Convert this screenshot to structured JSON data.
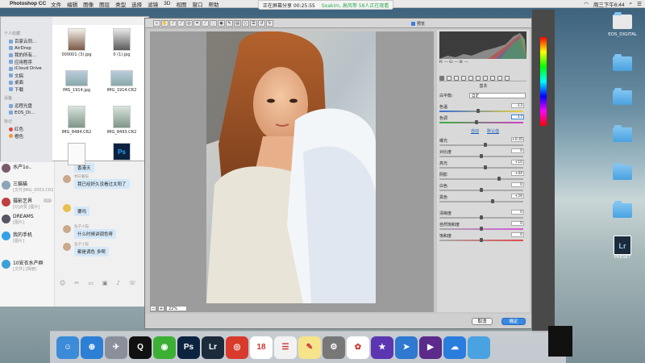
{
  "menubar": {
    "app": "Photoshop CC",
    "items": [
      "文件",
      "编辑",
      "图像",
      "图层",
      "类型",
      "选择",
      "滤镜",
      "3D",
      "视图",
      "窗口",
      "帮助"
    ],
    "right_status": "周三下午6:44"
  },
  "recording_banner": {
    "text": "正在屏幕分享 00:25:55",
    "extra": "Soakim, 高风等 58人正在观看"
  },
  "desktop_icons": [
    {
      "name": "folder",
      "label": ""
    },
    {
      "name": "EOS_DIGITAL",
      "label": "EOS_DIGITAL"
    },
    {
      "name": "folder2",
      "label": ""
    },
    {
      "name": "folder3",
      "label": ""
    },
    {
      "name": "folder4",
      "label": ""
    },
    {
      "name": "folder5",
      "label": ""
    },
    {
      "name": "folder6",
      "label": ""
    },
    {
      "name": "preset",
      "label": "PRESET"
    }
  ],
  "finder": {
    "sidebar": {
      "section_personal": "个人收藏",
      "items": [
        "百家云同...",
        "AirDrop",
        "我的所有...",
        "应用程序",
        "iCloud Drive",
        "文稿",
        "桌面",
        "下载"
      ],
      "section_devices": "设备",
      "devices": [
        "远程光盘",
        "EOS_DI..."
      ],
      "section_tags": "标记",
      "tags": [
        {
          "label": "红色",
          "color": "#e0443c"
        },
        {
          "label": "橙色",
          "color": "#f09a30"
        }
      ]
    },
    "files": [
      {
        "label": "000001 (3).jpg"
      },
      {
        "label": "0 (1).jpg"
      },
      {
        "label": "IMG_1914.jpg"
      },
      {
        "label": "IMG_1914.CR2"
      },
      {
        "label": "IMG_8484.CR2"
      },
      {
        "label": "IMG_8493.CR2"
      },
      {
        "label": ""
      },
      {
        "label": "Ps"
      }
    ]
  },
  "chat": {
    "contacts": [
      {
        "name": "水产1o..",
        "preview": "",
        "badge": ""
      },
      {
        "name": "三猫猫",
        "preview": "[文件]IMG_0003.CR2",
        "badge": ""
      },
      {
        "name": "摄影艺界",
        "preview": "[Q]点赞 [图片]",
        "badge": "37"
      },
      {
        "name": "DREAMS",
        "preview": "[图片]",
        "badge": ""
      },
      {
        "name": "我的手机",
        "preview": "[图片]",
        "badge": ""
      },
      {
        "name": "10安衣水产群",
        "preview": "[文件] [相册]",
        "badge": ""
      }
    ],
    "messages": [
      {
        "sender": "",
        "text": "香港天"
      },
      {
        "sender": "林日暮猫",
        "text": "我已经好久没看过太阳了"
      },
      {
        "sender": "",
        "text": "要吗"
      },
      {
        "sender": "鱼子小猫",
        "text": "什么时候讲调色呀"
      },
      {
        "sender": "鱼子小猫",
        "text": "都是调色 多啊"
      }
    ]
  },
  "acr": {
    "preview_label": "预览",
    "zoom": "22%",
    "tab_title": "基本",
    "wb_label": "白平衡:",
    "wb_value": "自定",
    "rgb_readout": "R: ---  G: ---  B: ---",
    "link_auto": "自动",
    "link_default": "默认值",
    "sliders": [
      {
        "label": "色温",
        "value": "-13",
        "pos": 0.46
      },
      {
        "label": "色调",
        "value": "-17",
        "pos": 0.44
      },
      {
        "label": "曝光",
        "value": "+0.45",
        "pos": 0.55
      },
      {
        "label": "对比度",
        "value": "0",
        "pos": 0.5
      },
      {
        "label": "高光",
        "value": "+10",
        "pos": 0.55
      },
      {
        "label": "阴影",
        "value": "+44",
        "pos": 0.72
      },
      {
        "label": "白色",
        "value": "0",
        "pos": 0.5
      },
      {
        "label": "黑色",
        "value": "+28",
        "pos": 0.64
      },
      {
        "label": "清晰度",
        "value": "0",
        "pos": 0.5
      },
      {
        "label": "自然饱和度",
        "value": "0",
        "pos": 0.5
      },
      {
        "label": "饱和度",
        "value": "0",
        "pos": 0.5
      }
    ],
    "cancel_label": "取消",
    "ok_label": "确定"
  },
  "dock": {
    "apps": [
      {
        "name": "finder",
        "glyph": "☺",
        "color": "#3b8bd8"
      },
      {
        "name": "safari",
        "glyph": "⊕",
        "color": "#2d7fd6"
      },
      {
        "name": "launchpad",
        "glyph": "✈",
        "color": "#8a8f9a"
      },
      {
        "name": "qq",
        "glyph": "Q",
        "color": "#111"
      },
      {
        "name": "wechat",
        "glyph": "◉",
        "color": "#3cb034"
      },
      {
        "name": "photoshop",
        "glyph": "Ps",
        "color": "#0c2340"
      },
      {
        "name": "lightroom",
        "glyph": "Lr",
        "color": "#1b2b3c"
      },
      {
        "name": "netease-music",
        "glyph": "◎",
        "color": "#d83a2c"
      },
      {
        "name": "calendar",
        "glyph": "18",
        "color": "#ffffff"
      },
      {
        "name": "reminders",
        "glyph": "☰",
        "color": "#f2f2f2"
      },
      {
        "name": "notes",
        "glyph": "✎",
        "color": "#f6e38a"
      },
      {
        "name": "system-preferences",
        "glyph": "⚙",
        "color": "#777"
      },
      {
        "name": "photos",
        "glyph": "✿",
        "color": "#ffffff"
      },
      {
        "name": "imovie",
        "glyph": "★",
        "color": "#5b36b0"
      },
      {
        "name": "feiyu",
        "glyph": "➤",
        "color": "#2f79d0"
      },
      {
        "name": "player",
        "glyph": "▶",
        "color": "#5b2a8a"
      },
      {
        "name": "baidu-netdisk",
        "glyph": "☁",
        "color": "#2a7ddc"
      },
      {
        "name": "downloads-stack",
        "glyph": "",
        "color": "#4aa2e0"
      }
    ]
  },
  "colors": {
    "accent": "#3b87e0",
    "ps_dark": "#494949"
  }
}
